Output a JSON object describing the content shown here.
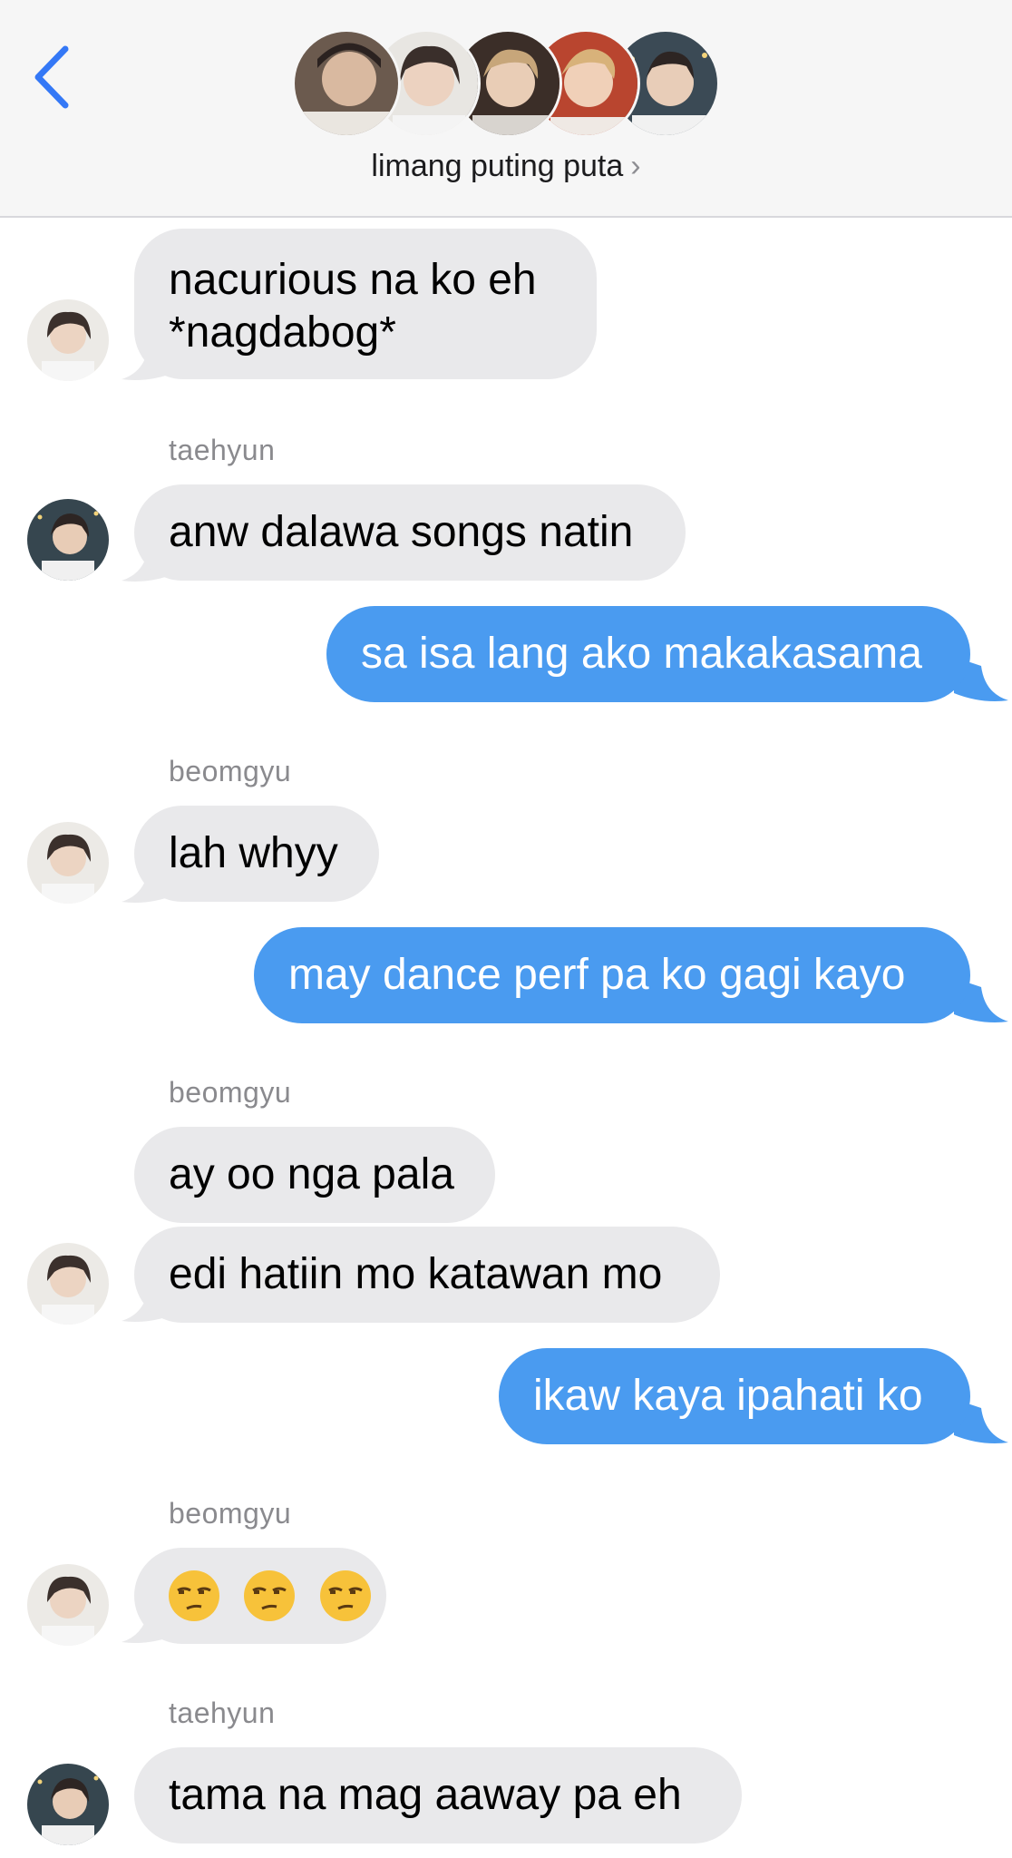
{
  "header": {
    "group_name": "limang puting puta",
    "chevron": "›",
    "back_icon": "chevron-left-icon",
    "avatars": [
      "member-avatar-1",
      "member-avatar-2",
      "member-avatar-3",
      "member-avatar-4",
      "member-avatar-5"
    ]
  },
  "colors": {
    "accent": "#3478f6",
    "incoming_bubble": "#e9e9eb",
    "outgoing_bubble": "#4a9bf0",
    "header_bg": "#f6f6f6"
  },
  "messages": [
    {
      "direction": "incoming",
      "text_line1": "nacurious na ko eh",
      "text_line2": "*nagdabog*"
    },
    {
      "direction": "incoming",
      "sender": "taehyun",
      "text": "anw dalawa songs natin"
    },
    {
      "direction": "outgoing",
      "text": "sa isa lang ako makakasama"
    },
    {
      "direction": "incoming",
      "sender": "beomgyu",
      "text": "lah whyy"
    },
    {
      "direction": "outgoing",
      "text": "may dance perf pa ko gagi kayo"
    },
    {
      "direction": "incoming",
      "sender": "beomgyu",
      "text": "ay oo nga pala"
    },
    {
      "direction": "incoming",
      "text": "edi hatiin mo katawan mo"
    },
    {
      "direction": "outgoing",
      "text": "ikaw kaya ipahati ko"
    },
    {
      "direction": "incoming",
      "sender": "beomgyu",
      "emojis": [
        "unamused-face-emoji",
        "unamused-face-emoji",
        "unamused-face-emoji"
      ]
    },
    {
      "direction": "incoming",
      "sender": "taehyun",
      "text": "tama na mag aaway pa eh"
    }
  ]
}
